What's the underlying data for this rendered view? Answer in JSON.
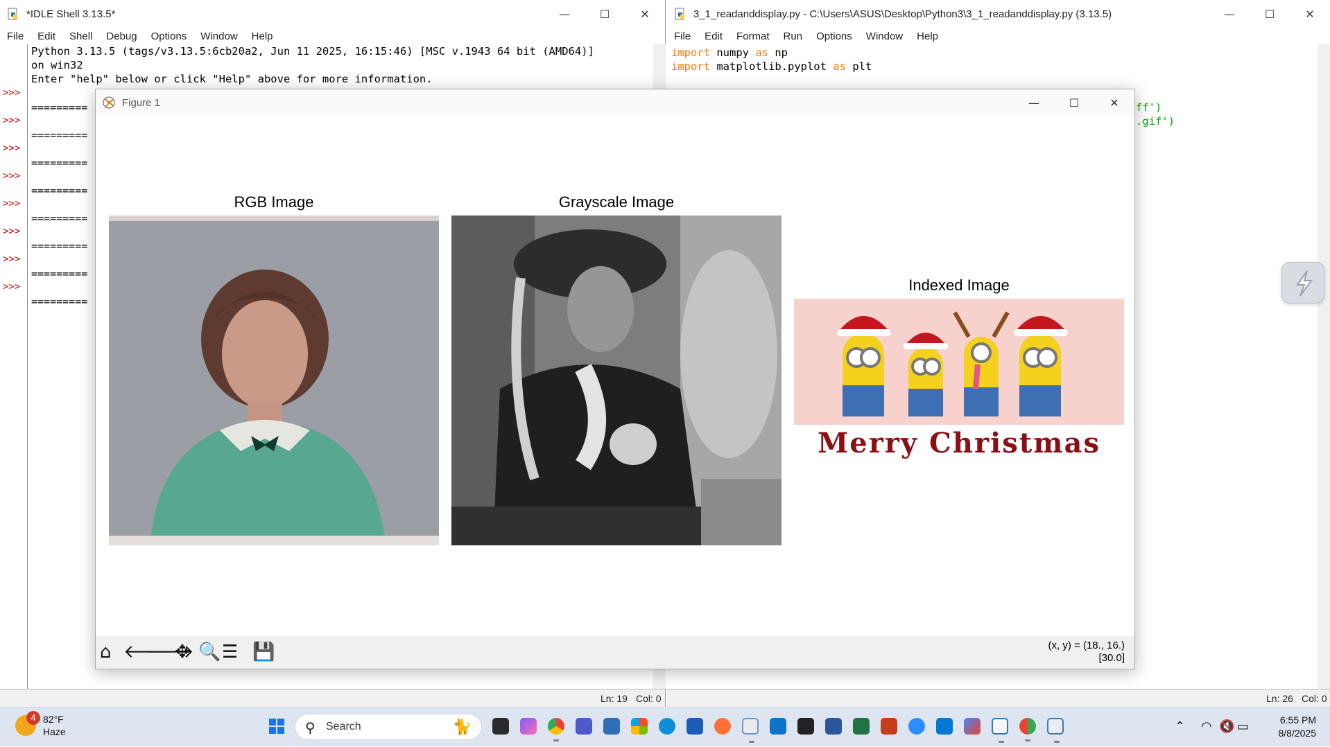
{
  "shell": {
    "title": "*IDLE Shell 3.13.5*",
    "menu": [
      "File",
      "Edit",
      "Shell",
      "Debug",
      "Options",
      "Window",
      "Help"
    ],
    "banner_line1": "Python 3.13.5 (tags/v3.13.5:6cb20a2, Jun 11 2025, 16:15:46) [MSC v.1943 64 bit (AMD64)]",
    "banner_line2": "on win32",
    "banner_line3": "Enter \"help\" below or click \"Help\" above for more information.",
    "prompt": ">>>",
    "separator": "=========",
    "status_ln": "Ln: 19",
    "status_col": "Col: 0"
  },
  "editor": {
    "title": "3_1_readanddisplay.py - C:\\Users\\ASUS\\Desktop\\Python3\\3_1_readanddisplay.py (3.13.5)",
    "menu": [
      "File",
      "Edit",
      "Format",
      "Run",
      "Options",
      "Window",
      "Help"
    ],
    "code": {
      "l1_kw": "import",
      "l1_rest": " numpy ",
      "l1_kw2": "as",
      "l1_end": " np",
      "l2_kw": "import",
      "l2_rest": " matplotlib.pyplot ",
      "l2_kw2": "as",
      "l2_end": " plt",
      "l3_frag": "ff')",
      "l4_frag": ".gif')"
    },
    "status_ln": "Ln: 26",
    "status_col": "Col: 0"
  },
  "figure": {
    "title": "Figure 1",
    "axes": [
      {
        "title": "RGB Image"
      },
      {
        "title": "Grayscale Image"
      },
      {
        "title": "Indexed Image",
        "banner_text": "Merry Christmas"
      }
    ],
    "coords_line1": "(x, y) = (18., 16.)",
    "coords_line2": "[30.0]",
    "toolbar_icons": [
      "home-icon",
      "back-icon",
      "forward-icon",
      "pan-icon",
      "zoom-icon",
      "configure-icon",
      "save-icon"
    ]
  },
  "taskbar": {
    "weather_badge": "4",
    "temperature": "82°F",
    "condition": "Haze",
    "search_label": "Search",
    "time": "6:55 PM",
    "date": "8/8/2025"
  },
  "window_controls": {
    "minimize": "—",
    "maximize": "☐",
    "close": "✕"
  }
}
